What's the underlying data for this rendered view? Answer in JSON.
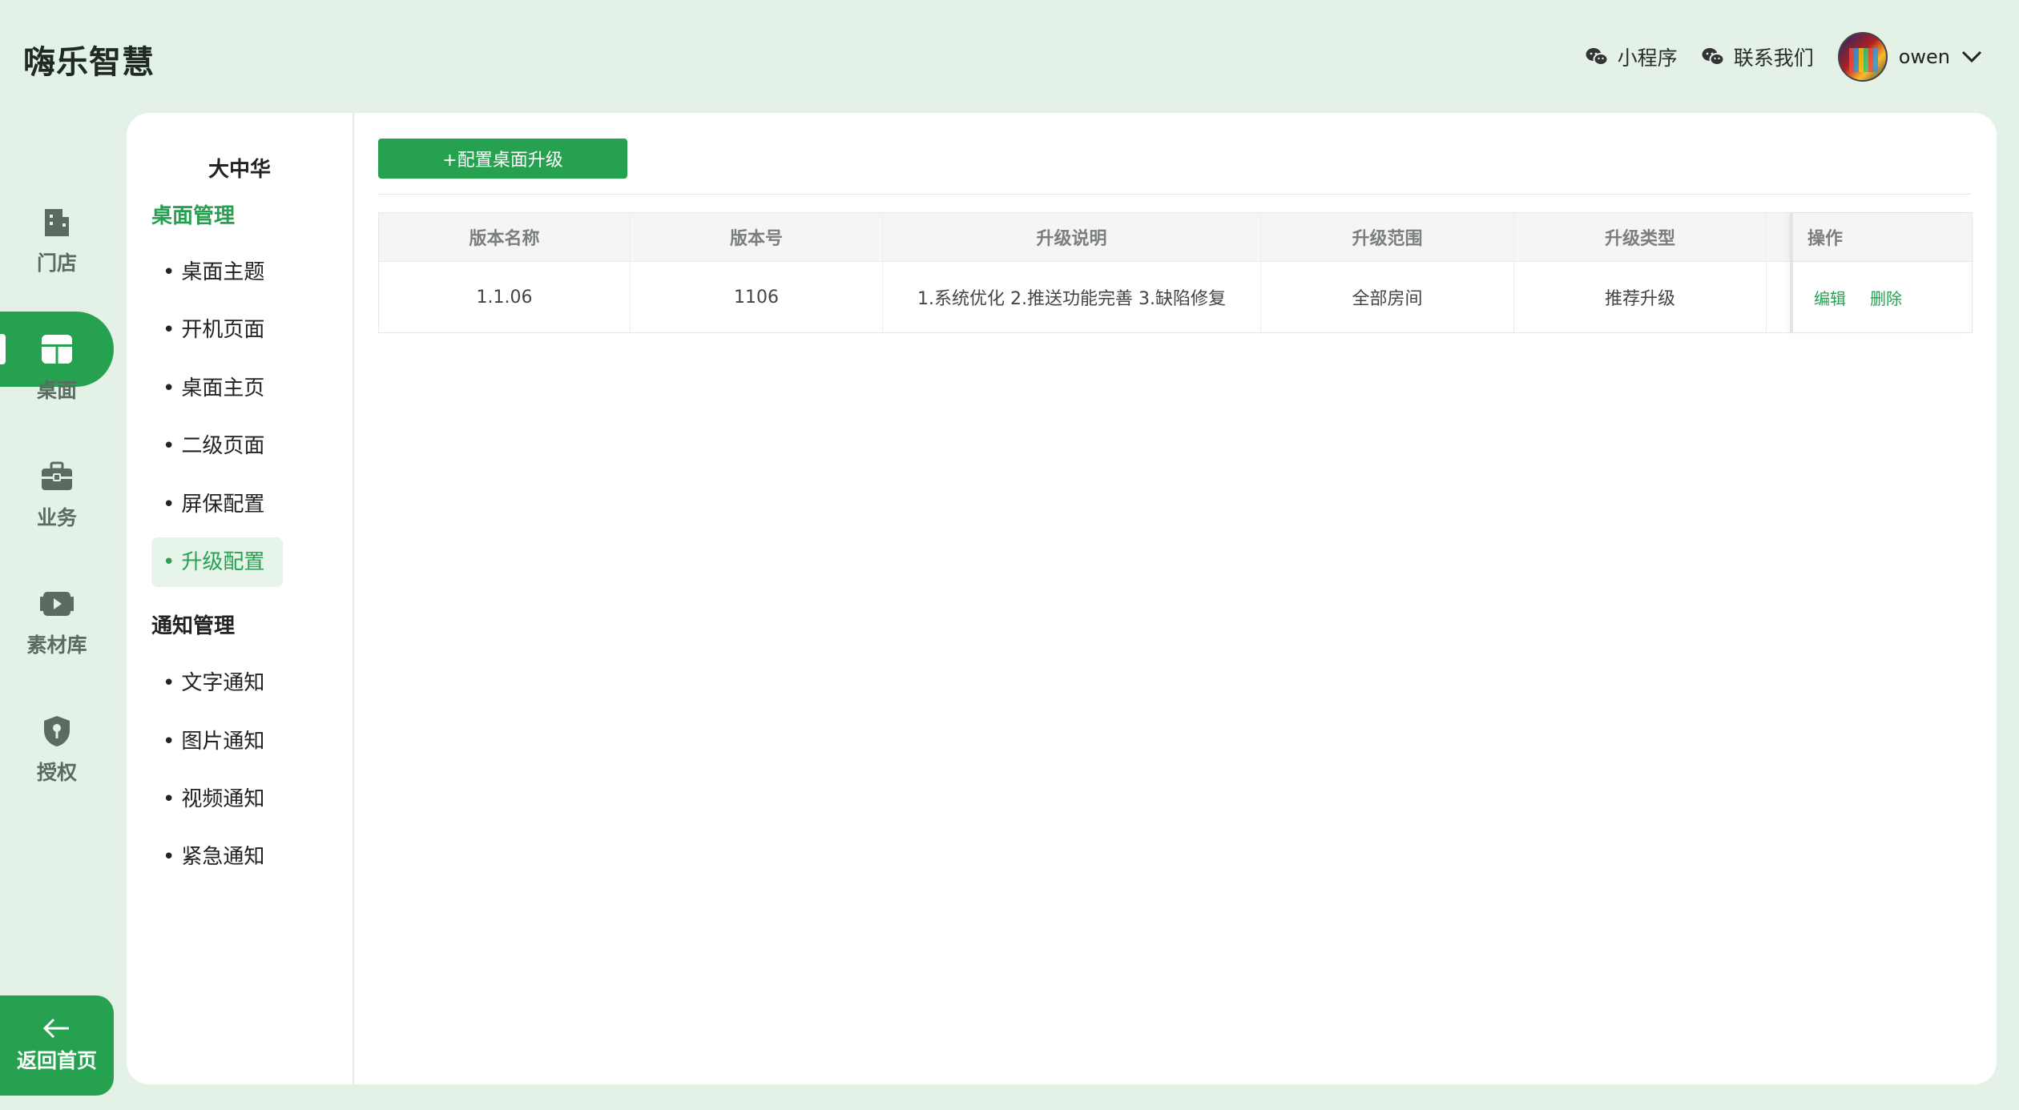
{
  "app": {
    "title": "嗨乐智慧"
  },
  "header": {
    "mini_program": "小程序",
    "contact_us": "联系我们",
    "username": "owen"
  },
  "rail": {
    "items": [
      {
        "label": "门店",
        "icon": "building-icon"
      },
      {
        "label": "桌面",
        "icon": "desktop-layout-icon"
      },
      {
        "label": "业务",
        "icon": "briefcase-icon"
      },
      {
        "label": "素材库",
        "icon": "video-library-icon"
      },
      {
        "label": "授权",
        "icon": "shield-key-icon"
      }
    ],
    "back_home": "返回首页"
  },
  "subnav": {
    "store_name": "大中华",
    "groups": [
      {
        "title": "桌面管理",
        "items": [
          "桌面主题",
          "开机页面",
          "桌面主页",
          "二级页面",
          "屏保配置",
          "升级配置"
        ]
      },
      {
        "title": "通知管理",
        "items": [
          "文字通知",
          "图片通知",
          "视频通知",
          "紧急通知"
        ]
      }
    ],
    "active_item": "升级配置"
  },
  "toolbar": {
    "add_label": "+配置桌面升级"
  },
  "table": {
    "columns": [
      "版本名称",
      "版本号",
      "升级说明",
      "升级范围",
      "升级类型",
      "操作"
    ],
    "rows": [
      {
        "version_name": "1.1.06",
        "version_code": "1106",
        "description": "1.系统优化 2.推送功能完善 3.缺陷修复",
        "scope": "全部房间",
        "type": "推荐升级",
        "edit": "编辑",
        "delete": "删除"
      }
    ]
  },
  "colors": {
    "accent": "#25a150",
    "background": "#e3f1e7",
    "panel": "#ffffff"
  }
}
